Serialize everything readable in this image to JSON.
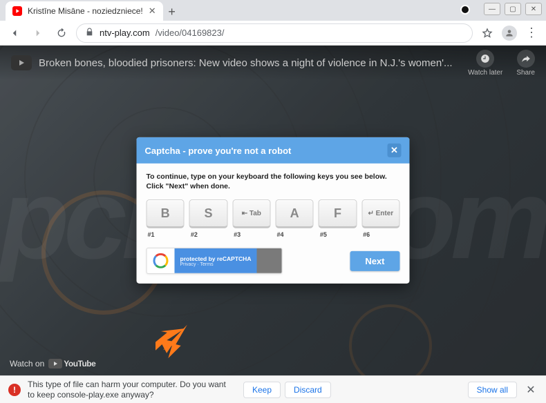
{
  "window": {
    "tab_title": "Kristīne Misāne - noziedzniece!",
    "url_host": "ntv-play.com",
    "url_path": "/video/04169823/"
  },
  "video": {
    "title": "Broken bones, bloodied prisoners: New video shows a night of violence in N.J.'s women'...",
    "watch_later": "Watch later",
    "share": "Share",
    "watch_on": "Watch on",
    "youtube_word": "YouTube"
  },
  "captcha": {
    "header": "Captcha - prove you're not a robot",
    "instruction_line1": "To continue, type on your keyboard the following keys you see below.",
    "instruction_line2": "Click \"Next\" when done.",
    "keys": [
      {
        "glyph": "B",
        "label": "#1",
        "wide": false
      },
      {
        "glyph": "S",
        "label": "#2",
        "wide": false
      },
      {
        "glyph": "⇤ Tab",
        "label": "#3",
        "wide": true
      },
      {
        "glyph": "A",
        "label": "#4",
        "wide": false
      },
      {
        "glyph": "F",
        "label": "#5",
        "wide": false
      },
      {
        "glyph": "↵ Enter",
        "label": "#6",
        "wide": true
      }
    ],
    "recaptcha_title": "protected by reCAPTCHA",
    "recaptcha_links": "Privacy · Terms",
    "next": "Next"
  },
  "download": {
    "warning": "This type of file can harm your computer. Do you want to keep console-play.exe anyway?",
    "keep": "Keep",
    "discard": "Discard",
    "show_all": "Show all"
  },
  "watermark": "pcrisk.com"
}
